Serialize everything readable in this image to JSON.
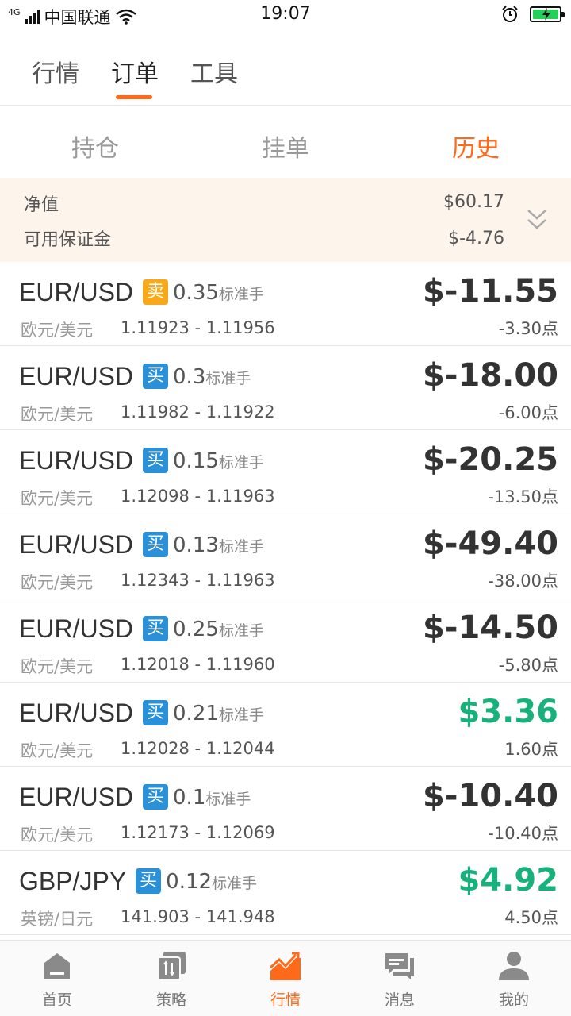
{
  "status_bar": {
    "network": "4G",
    "carrier": "中国联通",
    "time": "19:07"
  },
  "top_tabs": [
    {
      "label": "行情",
      "active": false
    },
    {
      "label": "订单",
      "active": true
    },
    {
      "label": "工具",
      "active": false
    }
  ],
  "sub_tabs": [
    {
      "label": "持仓",
      "active": false
    },
    {
      "label": "挂单",
      "active": false
    },
    {
      "label": "历史",
      "active": true
    }
  ],
  "summary": {
    "net_value_label": "净值",
    "net_value": "$60.17",
    "margin_label": "可用保证金",
    "margin": "$-4.76"
  },
  "lot_unit": "标准手",
  "orders": [
    {
      "pair": "EUR/USD",
      "side": "卖",
      "side_type": "sell",
      "lot": "0.35",
      "cname": "欧元/美元",
      "prices": "1.11923 - 1.11956",
      "profit": "$-11.55",
      "points": "-3.30点",
      "positive": false
    },
    {
      "pair": "EUR/USD",
      "side": "买",
      "side_type": "buy",
      "lot": "0.3",
      "cname": "欧元/美元",
      "prices": "1.11982 - 1.11922",
      "profit": "$-18.00",
      "points": "-6.00点",
      "positive": false
    },
    {
      "pair": "EUR/USD",
      "side": "买",
      "side_type": "buy",
      "lot": "0.15",
      "cname": "欧元/美元",
      "prices": "1.12098 - 1.11963",
      "profit": "$-20.25",
      "points": "-13.50点",
      "positive": false
    },
    {
      "pair": "EUR/USD",
      "side": "买",
      "side_type": "buy",
      "lot": "0.13",
      "cname": "欧元/美元",
      "prices": "1.12343 - 1.11963",
      "profit": "$-49.40",
      "points": "-38.00点",
      "positive": false
    },
    {
      "pair": "EUR/USD",
      "side": "买",
      "side_type": "buy",
      "lot": "0.25",
      "cname": "欧元/美元",
      "prices": "1.12018 - 1.11960",
      "profit": "$-14.50",
      "points": "-5.80点",
      "positive": false
    },
    {
      "pair": "EUR/USD",
      "side": "买",
      "side_type": "buy",
      "lot": "0.21",
      "cname": "欧元/美元",
      "prices": "1.12028 - 1.12044",
      "profit": "$3.36",
      "points": "1.60点",
      "positive": true
    },
    {
      "pair": "EUR/USD",
      "side": "买",
      "side_type": "buy",
      "lot": "0.1",
      "cname": "欧元/美元",
      "prices": "1.12173 - 1.12069",
      "profit": "$-10.40",
      "points": "-10.40点",
      "positive": false
    },
    {
      "pair": "GBP/JPY",
      "side": "买",
      "side_type": "buy",
      "lot": "0.12",
      "cname": "英镑/日元",
      "prices": "141.903 - 141.948",
      "profit": "$4.92",
      "points": "4.50点",
      "positive": true
    }
  ],
  "bottom_nav": [
    {
      "label": "首页",
      "icon": "home-icon",
      "active": false
    },
    {
      "label": "策略",
      "icon": "strategy-icon",
      "active": false
    },
    {
      "label": "行情",
      "icon": "market-chart-icon",
      "active": true
    },
    {
      "label": "消息",
      "icon": "message-icon",
      "active": false
    },
    {
      "label": "我的",
      "icon": "profile-icon",
      "active": false
    }
  ],
  "colors": {
    "accent": "#ff6a1a",
    "buy": "#2a90d8",
    "sell": "#f9a81a",
    "positive": "#17b27c",
    "summary_bg": "#fdf4ec"
  }
}
